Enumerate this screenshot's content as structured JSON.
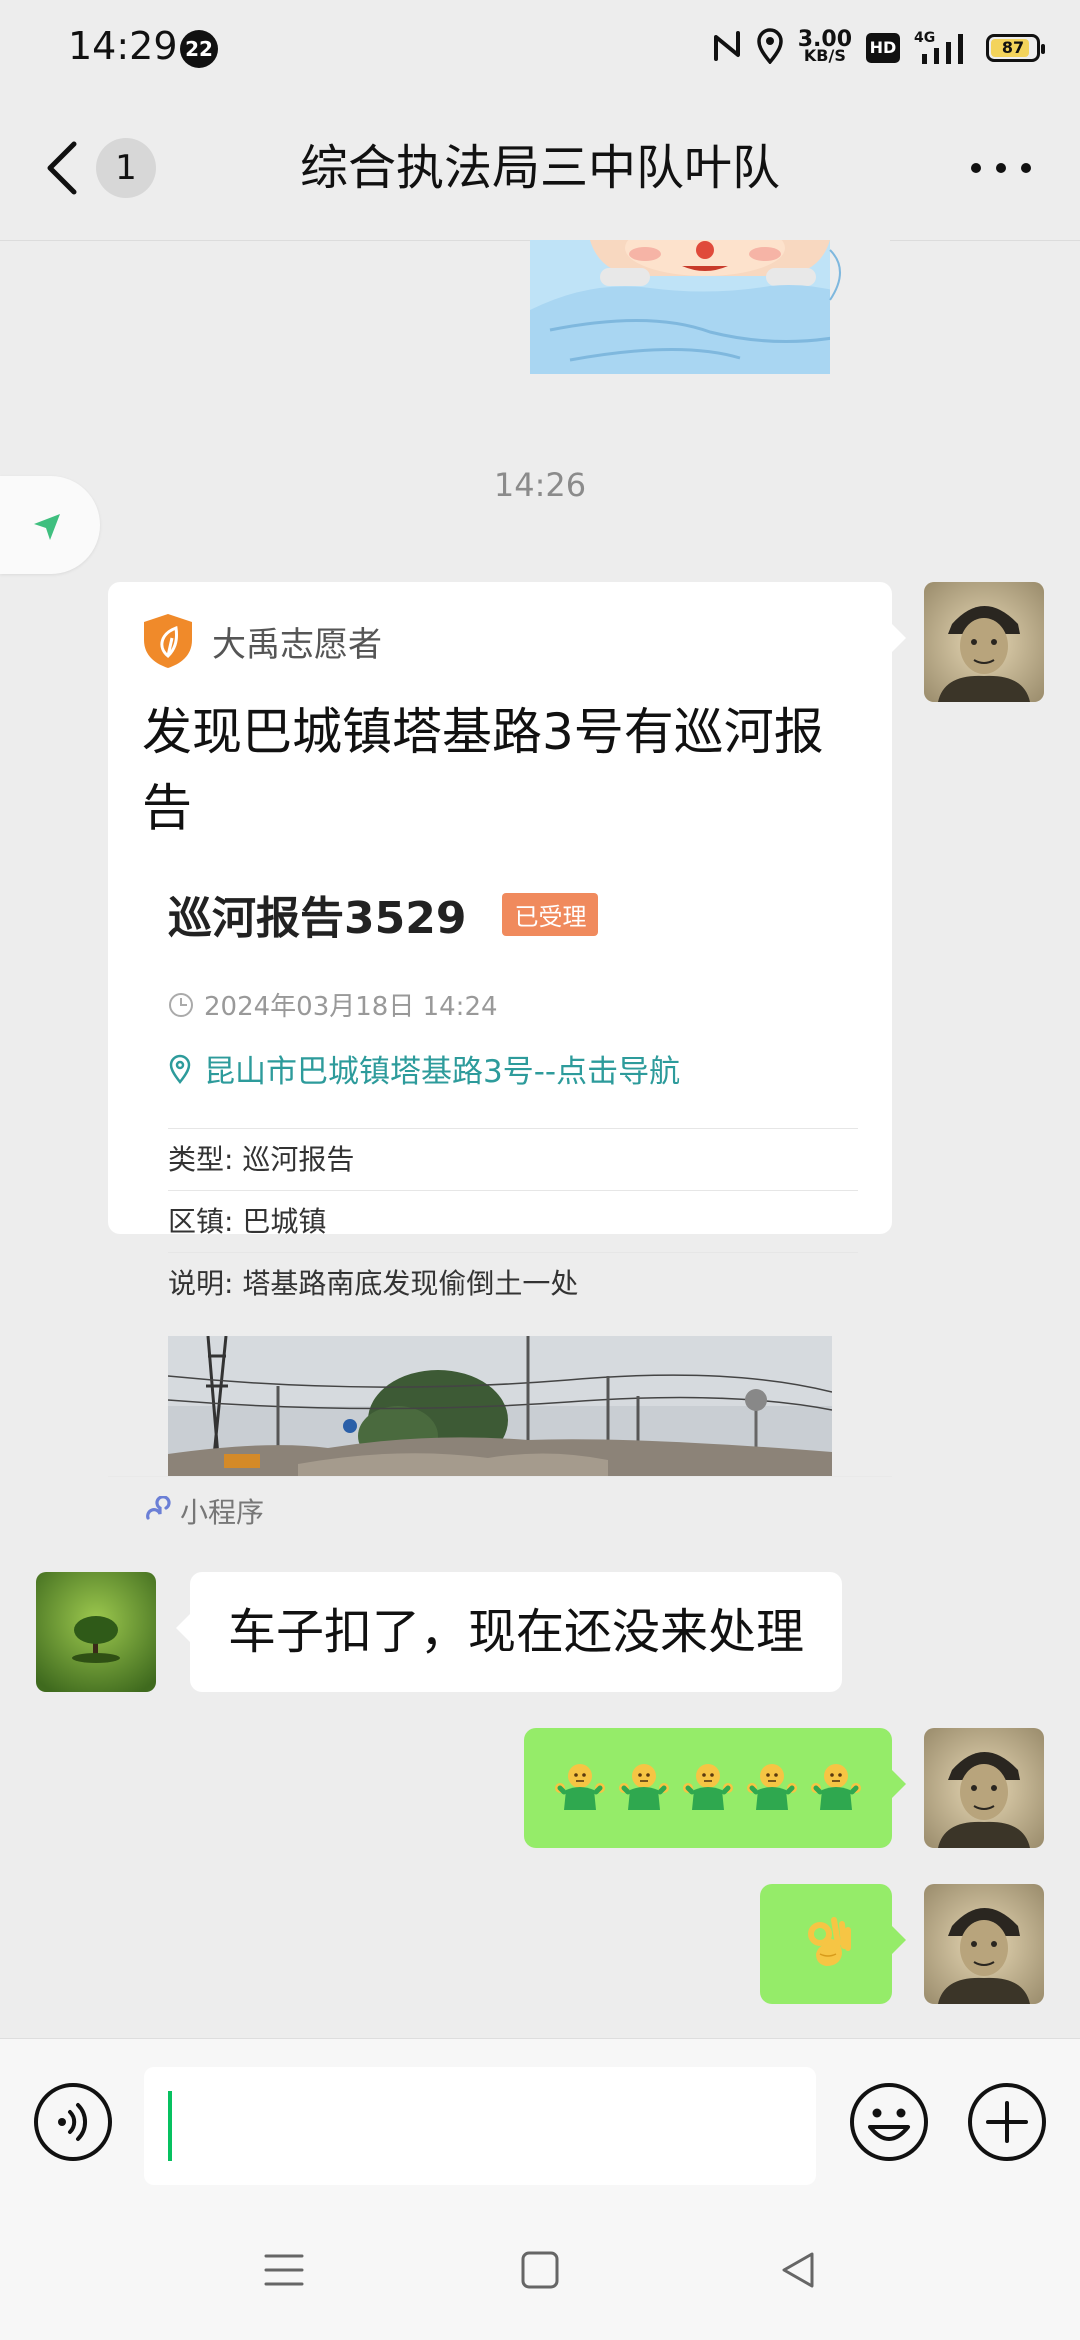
{
  "status_bar": {
    "time": "14:29",
    "notification_count": "22",
    "net_speed": "3.00",
    "net_unit": "KB/S",
    "hd": "HD",
    "network": "4G",
    "battery": "87",
    "battery_level": 0.87,
    "icons": [
      "nfc-icon",
      "location-icon",
      "signal-icon",
      "battery-icon"
    ]
  },
  "nav": {
    "unread_count": "1",
    "title": "综合执法局三中队叶队"
  },
  "chat": {
    "timestamp": "14:26",
    "shared_card": {
      "source": "大禹志愿者",
      "title": "发现巴城镇塔基路3号有巡河报告",
      "report_title": "巡河报告3529",
      "status_badge": "已受理",
      "datetime": "2024年03月18日 14:24",
      "address": "昆山市巴城镇塔基路3号--点击导航",
      "rows": [
        {
          "label": "类型:",
          "value": "巡河报告"
        },
        {
          "label": "区镇:",
          "value": "巴城镇"
        },
        {
          "label": "说明:",
          "value": "塔基路南底发现偷倒土一处"
        }
      ],
      "footer": "小程序"
    },
    "messages": [
      {
        "side": "left",
        "text": "车子扣了，现在还没来处理"
      },
      {
        "side": "right",
        "emoji": "man-shrugging-emoji",
        "count": 5
      },
      {
        "side": "right",
        "emoji": "ok-hand-emoji",
        "count": 1
      }
    ]
  },
  "colors": {
    "background": "#ededed",
    "self_bubble": "#95ec69",
    "address_link": "#2d9b9b",
    "status_badge": "#f08a5d",
    "caret": "#07c160"
  }
}
